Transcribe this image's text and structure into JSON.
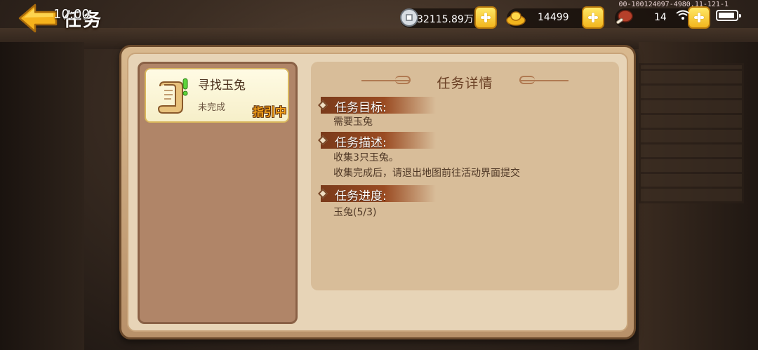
{
  "status_bar": {
    "time": "10:00",
    "debug_text": "00-100124097-4980.11-121-1"
  },
  "header": {
    "title": "任务"
  },
  "currencies": {
    "silver": "32115.89万",
    "gold": "14499",
    "food": "14"
  },
  "task_list": {
    "items": [
      {
        "name": "寻找玉兔",
        "status": "未完成",
        "tag": "指引中"
      }
    ]
  },
  "detail": {
    "title": "任务详情",
    "goal_label": "任务目标:",
    "goal_text": "需要玉兔",
    "desc_label": "任务描述:",
    "desc_line1": "收集3只玉兔。",
    "desc_line2": "收集完成后，请退出地图前往活动界面提交",
    "progress_label": "任务进度:",
    "progress_text": "玉兔(5/3)"
  },
  "colors": {
    "accent_orange": "#f4a21b",
    "section_red": "#7a3a1a",
    "panel_bg": "#e7d4b7"
  }
}
